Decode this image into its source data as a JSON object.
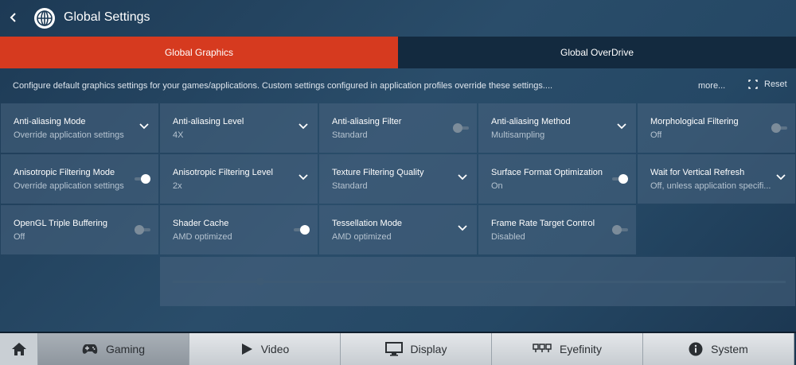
{
  "header": {
    "title": "Global Settings"
  },
  "tabs": [
    {
      "label": "Global Graphics",
      "active": true
    },
    {
      "label": "Global OverDrive",
      "active": false
    }
  ],
  "description": {
    "text": "Configure default graphics settings for your games/applications. Custom settings configured in application profiles override these settings....",
    "more": "more...",
    "reset": "Reset"
  },
  "settings": [
    {
      "label": "Anti-aliasing Mode",
      "value": "Override application settings",
      "control": "dropdown"
    },
    {
      "label": "Anti-aliasing Level",
      "value": "4X",
      "control": "dropdown"
    },
    {
      "label": "Anti-aliasing Filter",
      "value": "Standard",
      "control": "toggle-off"
    },
    {
      "label": "Anti-aliasing Method",
      "value": "Multisampling",
      "control": "dropdown"
    },
    {
      "label": "Morphological Filtering",
      "value": "Off",
      "control": "toggle-off"
    },
    {
      "label": "Anisotropic Filtering Mode",
      "value": "Override application settings",
      "control": "toggle-on"
    },
    {
      "label": "Anisotropic Filtering Level",
      "value": "2x",
      "control": "dropdown"
    },
    {
      "label": "Texture Filtering Quality",
      "value": "Standard",
      "control": "dropdown"
    },
    {
      "label": "Surface Format Optimization",
      "value": "On",
      "control": "toggle-on"
    },
    {
      "label": "Wait for Vertical Refresh",
      "value": "Off, unless application specifi...",
      "control": "dropdown"
    },
    {
      "label": "OpenGL Triple Buffering",
      "value": "Off",
      "control": "toggle-off"
    },
    {
      "label": "Shader Cache",
      "value": "AMD optimized",
      "control": "toggle-on"
    },
    {
      "label": "Tessellation Mode",
      "value": "AMD optimized",
      "control": "dropdown"
    },
    {
      "label": "Frame Rate Target Control",
      "value": "Disabled",
      "control": "toggle-off"
    }
  ],
  "bottom_nav": [
    {
      "label": "Gaming",
      "icon": "gamepad-icon",
      "active": true
    },
    {
      "label": "Video",
      "icon": "play-icon",
      "active": false
    },
    {
      "label": "Display",
      "icon": "monitor-icon",
      "active": false
    },
    {
      "label": "Eyefinity",
      "icon": "multi-display-icon",
      "active": false
    },
    {
      "label": "System",
      "icon": "info-icon",
      "active": false
    }
  ],
  "colors": {
    "accent": "#d63a1f",
    "tab_inactive": "#132a3f"
  }
}
